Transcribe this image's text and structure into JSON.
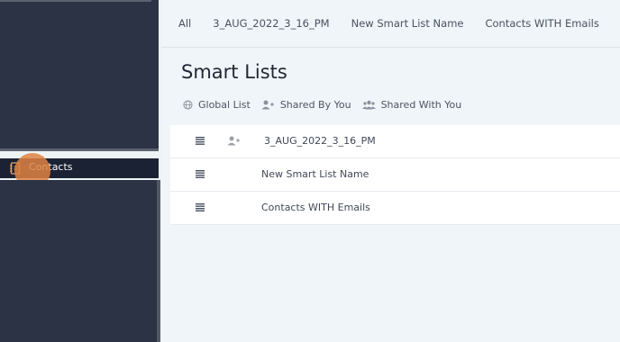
{
  "sidebar": {
    "active_item": {
      "label": "Contacts",
      "icon": "contacts-book-icon"
    }
  },
  "tabs": [
    "All",
    "3_AUG_2022_3_16_PM",
    "New Smart List Name",
    "Contacts WITH Emails"
  ],
  "page_title": "Smart Lists",
  "filters": [
    {
      "label": "Global List",
      "icon": "globe-icon"
    },
    {
      "label": "Shared By You",
      "icon": "user-plus-icon"
    },
    {
      "label": "Shared With You",
      "icon": "users-icon"
    }
  ],
  "lists": [
    {
      "name": "3_AUG_2022_3_16_PM",
      "shared": true
    },
    {
      "name": "New Smart List Name",
      "shared": false
    },
    {
      "name": "Contacts WITH Emails",
      "shared": false
    }
  ],
  "colors": {
    "sidebar": "#2c3345",
    "sidebar_active": "#1b2233",
    "accent": "#de8242",
    "background": "#eff5f8"
  }
}
